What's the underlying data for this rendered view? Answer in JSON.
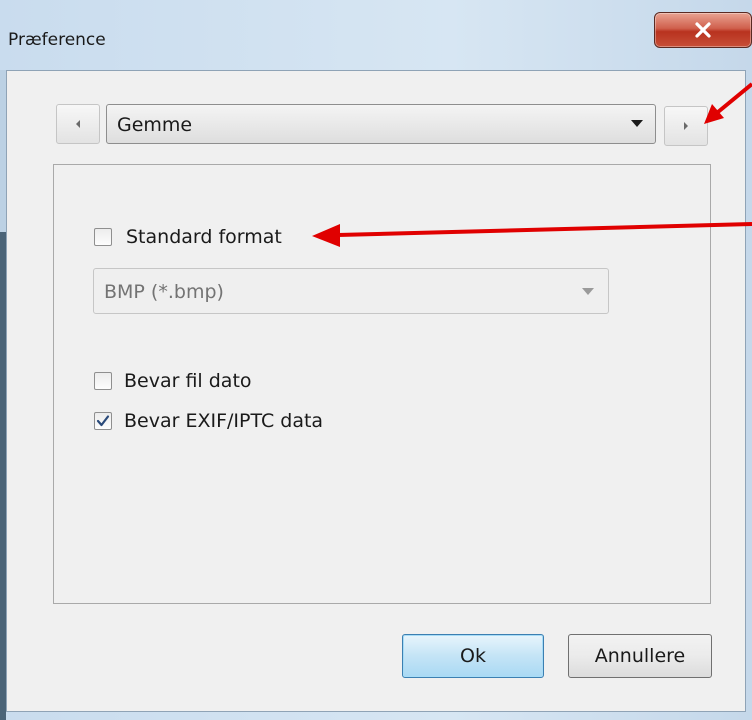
{
  "window": {
    "title": "Præference",
    "close_icon": "close-x-icon"
  },
  "navigation": {
    "prev_icon": "chevron-left-icon",
    "next_icon": "chevron-right-icon",
    "selected_page": "Gemme",
    "dropdown_icon": "dropdown-arrow-icon"
  },
  "options": {
    "standard_format": {
      "label": "Standard format",
      "checked": false
    },
    "format_select": {
      "value": "BMP (*.bmp)",
      "enabled": false
    },
    "keep_file_date": {
      "label": "Bevar fil dato",
      "checked": false
    },
    "keep_exif": {
      "label": "Bevar EXIF/IPTC data",
      "checked": true
    }
  },
  "buttons": {
    "ok_label": "Ok",
    "cancel_label": "Annullere"
  },
  "colors": {
    "annotation_arrow": "#e00000",
    "close_button": "#c9442e",
    "ok_border": "#3c7fb1"
  }
}
